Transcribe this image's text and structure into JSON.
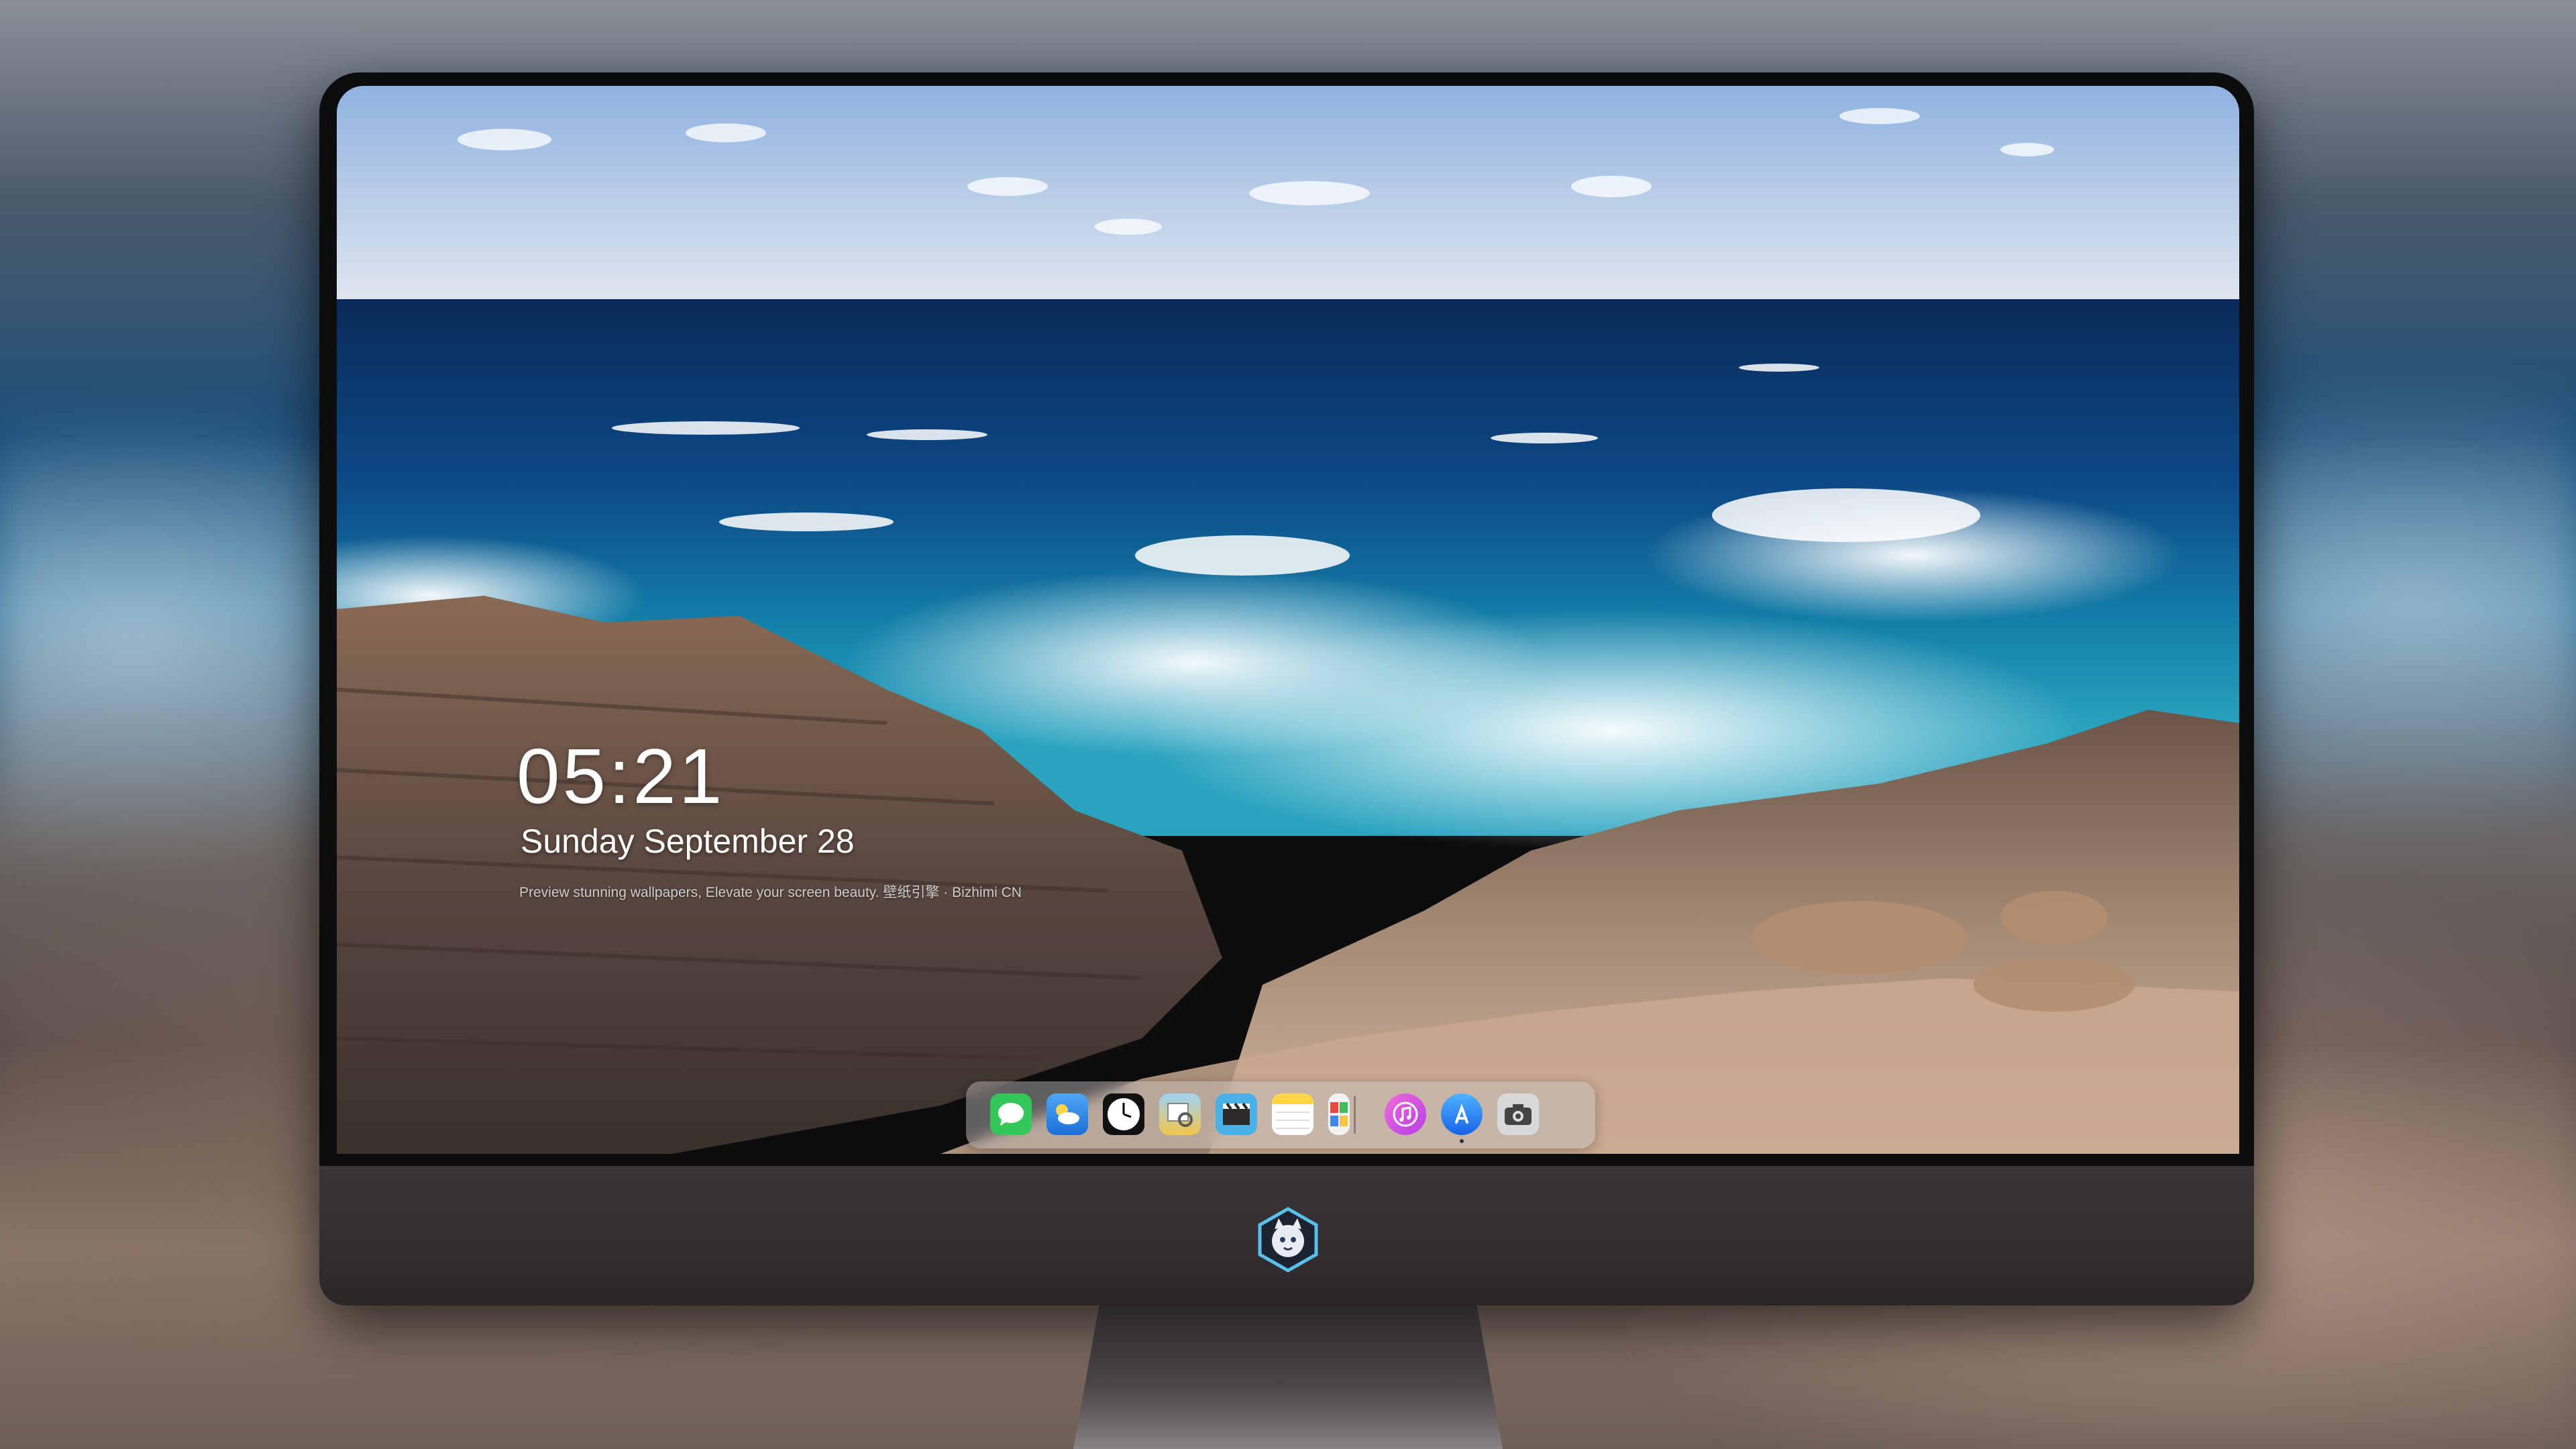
{
  "lockscreen": {
    "time": "05:21",
    "date": "Sunday September  28",
    "tagline": "Preview stunning wallpapers, Elevate your screen beauty. 壁纸引擎 · Bizhimi CN"
  },
  "dock": {
    "apps": [
      {
        "name": "Messages",
        "icon": "messages-icon",
        "color": "#35c759"
      },
      {
        "name": "Weather",
        "icon": "weather-icon",
        "color": "#2f8cf0"
      },
      {
        "name": "Clock",
        "icon": "clock-icon",
        "color": "#111111"
      },
      {
        "name": "Preview",
        "icon": "preview-icon",
        "color": "#f3c64a"
      },
      {
        "name": "Clips",
        "icon": "clips-icon",
        "color": "#4ab0e8"
      },
      {
        "name": "Notes",
        "icon": "notes-icon",
        "color": "#ffd54a"
      },
      {
        "name": "Photo Booth",
        "icon": "photo-booth-icon",
        "color": "#e64a3c"
      },
      {
        "name": "iTunes",
        "icon": "itunes-icon",
        "color": "#e046d8"
      },
      {
        "name": "App Store",
        "icon": "app-store-icon",
        "color": "#1e90ff"
      },
      {
        "name": "Camera",
        "icon": "camera-icon",
        "color": "#6c6c6c"
      }
    ]
  },
  "monitor": {
    "logo": "cat-mascot-logo"
  }
}
